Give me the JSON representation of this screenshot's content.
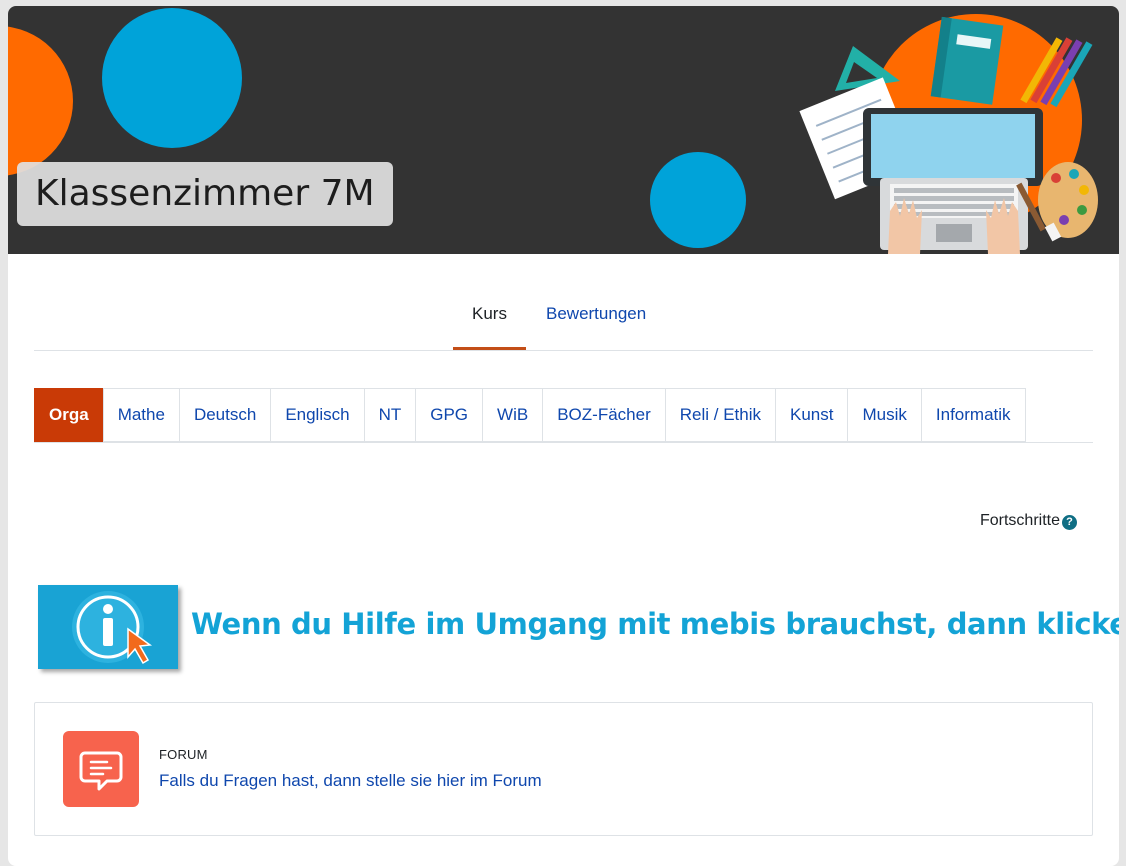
{
  "course": {
    "title": "Klassenzimmer 7M"
  },
  "primary_nav": {
    "tabs": [
      {
        "label": "Kurs",
        "active": true
      },
      {
        "label": "Bewertungen",
        "active": false
      }
    ]
  },
  "subject_tabs": [
    {
      "label": "Orga",
      "active": true
    },
    {
      "label": "Mathe"
    },
    {
      "label": "Deutsch"
    },
    {
      "label": "Englisch"
    },
    {
      "label": "NT"
    },
    {
      "label": "GPG"
    },
    {
      "label": "WiB"
    },
    {
      "label": "BOZ-Fächer"
    },
    {
      "label": "Reli / Ethik"
    },
    {
      "label": "Kunst"
    },
    {
      "label": "Musik"
    },
    {
      "label": "Informatik"
    }
  ],
  "progress": {
    "label": "Fortschritte",
    "help_icon": "question-circle-icon"
  },
  "info_banner": {
    "text": "Wenn du Hilfe im Umgang mit mebis brauchst, dann klicke hier!",
    "icon": "info-cursor-icon"
  },
  "activity": {
    "type": "FORUM",
    "name": "Falls du Fragen hast, dann stelle sie hier im Forum",
    "icon": "forum-icon"
  },
  "colors": {
    "accent": "#c93a06",
    "link": "#0f47ad",
    "info": "#13a3d6",
    "forum": "#f7634d",
    "banner_bg": "#333333",
    "banner_orange": "#ff6a00",
    "banner_blue": "#00a3d9"
  }
}
